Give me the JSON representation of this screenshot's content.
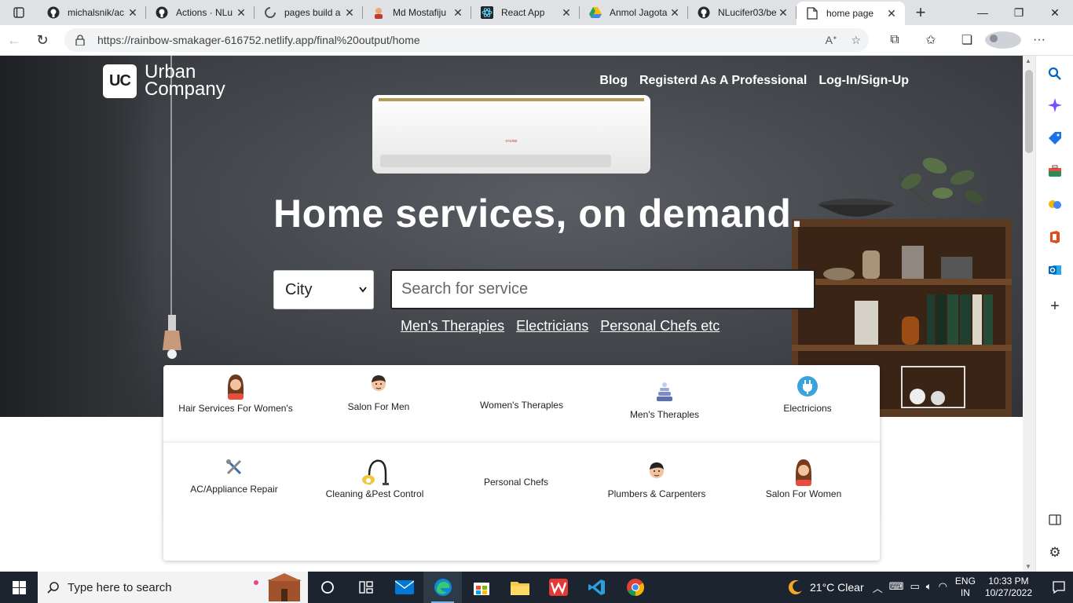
{
  "browser": {
    "tabs": [
      {
        "title": "michalsnik/ac",
        "favicon": "github-icon"
      },
      {
        "title": "Actions · NLu",
        "favicon": "github-icon"
      },
      {
        "title": "pages build a",
        "favicon": "loading-icon"
      },
      {
        "title": "Md Mostafiju",
        "favicon": "profile-icon"
      },
      {
        "title": "React App",
        "favicon": "react-icon"
      },
      {
        "title": "Anmol Jagota",
        "favicon": "drive-icon"
      },
      {
        "title": "NLucifer03/be",
        "favicon": "github-icon"
      },
      {
        "title": "home page",
        "favicon": "page-icon",
        "active": true
      }
    ],
    "url": "https://rainbow-smakager-616752.netlify.app/final%20output/home"
  },
  "page": {
    "logo": {
      "mark": "UC",
      "line1": "Urban",
      "line2": "Company"
    },
    "nav": [
      "Blog",
      "Registerd As A Professional",
      "Log-In/Sign-Up"
    ],
    "headline": "Home services, on demand.",
    "city_select": "City",
    "search_placeholder": "Search for service",
    "quick_links": [
      "Men's Therapies",
      "Electricians",
      "Personal Chefs etc"
    ],
    "services_row1": [
      {
        "label": "Hair Services For Women's",
        "icon": "woman-avatar-icon"
      },
      {
        "label": "Salon For Men",
        "icon": "man-avatar-icon"
      },
      {
        "label": "Women's Theraples",
        "icon": ""
      },
      {
        "label": "Men's Theraples",
        "icon": "massage-icon"
      },
      {
        "label": "Electricions",
        "icon": "plug-icon"
      }
    ],
    "services_row2": [
      {
        "label": "AC/Appliance Repair",
        "icon": "tools-icon"
      },
      {
        "label": "Cleaning &Pest Control",
        "icon": "vacuum-icon"
      },
      {
        "label": "Personal Chefs",
        "icon": ""
      },
      {
        "label": "Plumbers & Carpenters",
        "icon": "man-avatar-icon"
      },
      {
        "label": "Salon For Women",
        "icon": "woman-avatar-icon"
      }
    ],
    "ac_brand": "cruise"
  },
  "taskbar": {
    "search_placeholder": "Type here to search",
    "weather": "21°C  Clear",
    "lang1": "ENG",
    "lang2": "IN",
    "time": "10:33 PM",
    "date": "10/27/2022"
  },
  "colors": {
    "hero": "#44474c",
    "taskbar": "#1c2430",
    "accent": "#0078d4"
  }
}
